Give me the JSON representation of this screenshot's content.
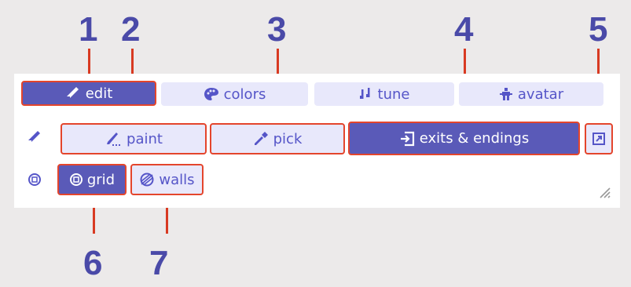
{
  "tabs": [
    {
      "label": "edit",
      "icon": "pencil-icon",
      "active": true
    },
    {
      "label": "colors",
      "icon": "palette-icon",
      "active": false
    },
    {
      "label": "tune",
      "icon": "music-note-icon",
      "active": false
    },
    {
      "label": "avatar",
      "icon": "person-icon",
      "active": false
    }
  ],
  "edit_tools": [
    {
      "label": "paint",
      "icon": "brush-icon",
      "active": false
    },
    {
      "label": "pick",
      "icon": "eyedropper-icon",
      "active": false
    },
    {
      "label": "exits & endings",
      "icon": "exit-door-icon",
      "active": true
    }
  ],
  "toggles": [
    {
      "label": "grid",
      "icon": "grid-toggle-icon",
      "active": true
    },
    {
      "label": "walls",
      "icon": "walls-icon",
      "active": false
    }
  ],
  "callouts": [
    "1",
    "2",
    "3",
    "4",
    "5",
    "6",
    "7"
  ],
  "colors": {
    "accent": "#5a5ab8",
    "inactive": "#e8e8fb",
    "highlight": "#e4452c",
    "callout": "#4a4aa8"
  }
}
